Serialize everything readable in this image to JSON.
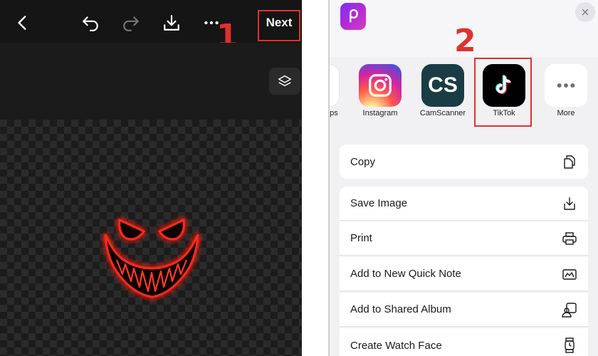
{
  "editor": {
    "next_label": "Next",
    "step_one": "1",
    "icons": [
      "back-icon",
      "undo-icon",
      "redo-icon",
      "download-icon",
      "more-icon",
      "layers-icon"
    ]
  },
  "share_sheet": {
    "step_two": "2",
    "apps": [
      {
        "label": "aps",
        "icon": "app-partial-icon"
      },
      {
        "label": "Instagram",
        "icon": "instagram-icon"
      },
      {
        "label": "CamScanner",
        "icon": "camscanner-icon",
        "badge": "CS"
      },
      {
        "label": "TikTok",
        "icon": "tiktok-icon"
      },
      {
        "label": "More",
        "icon": "more-icon"
      }
    ],
    "actions": [
      {
        "label": "Copy",
        "icon": "copy-icon"
      },
      {
        "label": "Save Image",
        "icon": "save-icon"
      },
      {
        "label": "Print",
        "icon": "print-icon"
      },
      {
        "label": "Add to New Quick Note",
        "icon": "quick-note-icon"
      },
      {
        "label": "Add to Shared Album",
        "icon": "shared-album-icon"
      },
      {
        "label": "Create Watch Face",
        "icon": "watch-icon"
      }
    ]
  },
  "colors": {
    "highlight": "#e0312e",
    "editor_bg": "#151515",
    "sheet_bg": "#f1f1f4"
  }
}
